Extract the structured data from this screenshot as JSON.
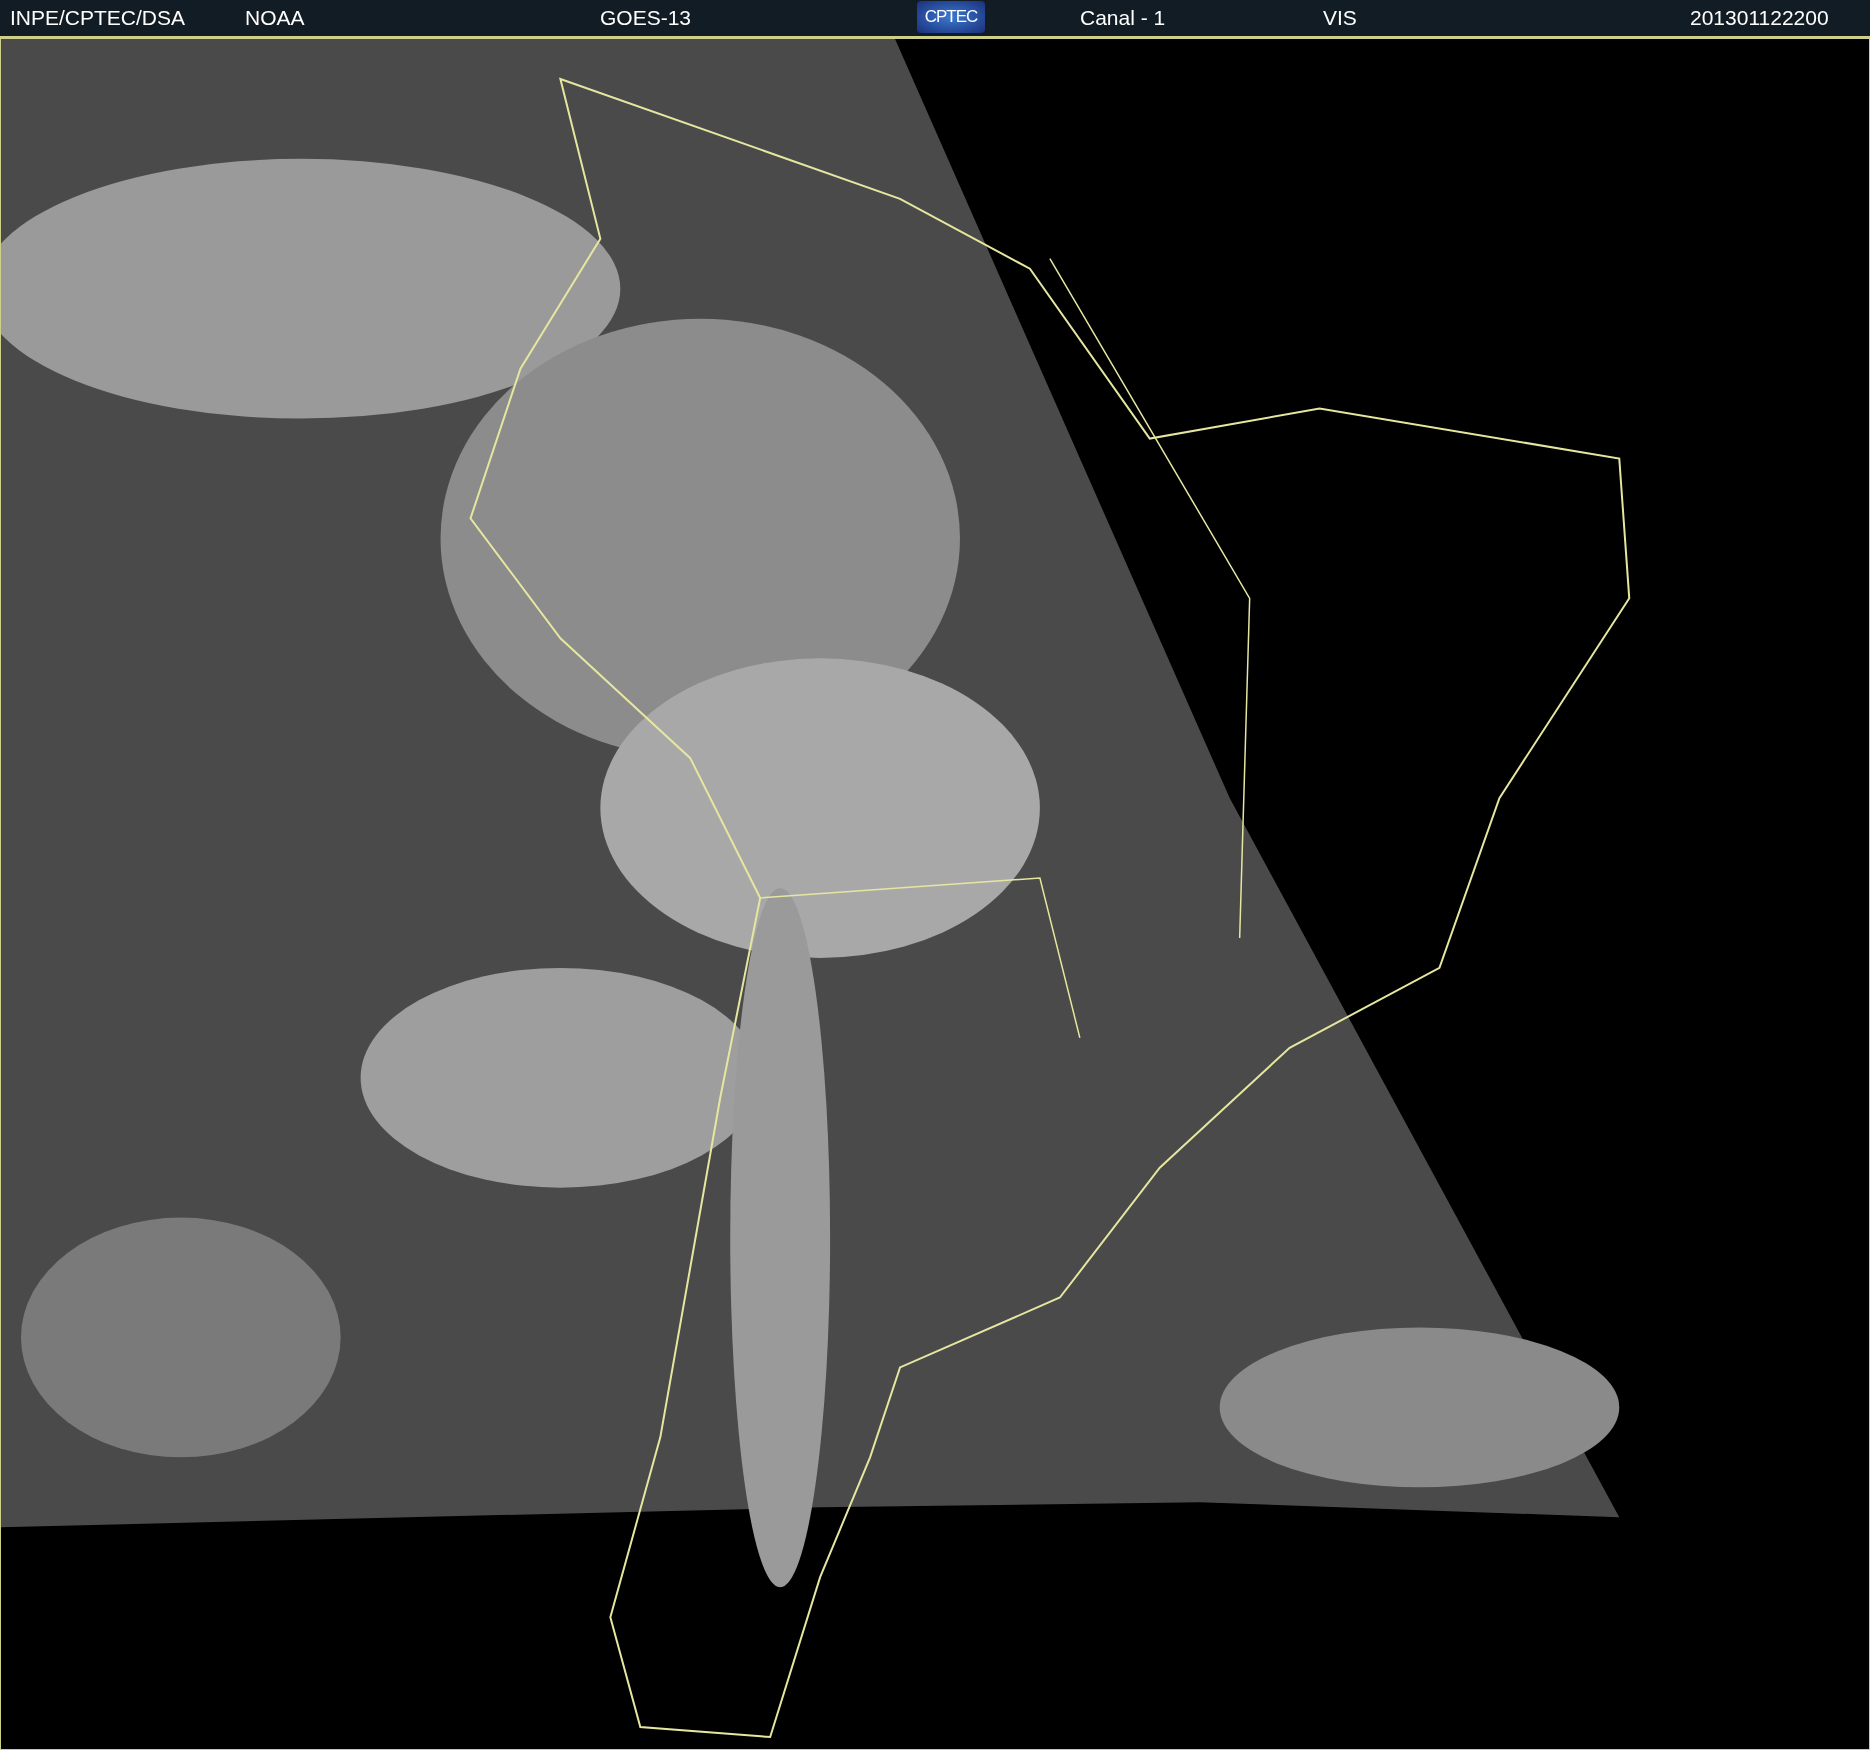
{
  "header": {
    "source": "INPE/CPTEC/DSA",
    "agency": "NOAA",
    "satellite": "GOES-13",
    "logo": "CPTEC",
    "channel": "Canal - 1",
    "band": "VIS",
    "timestamp": "201301122200"
  }
}
